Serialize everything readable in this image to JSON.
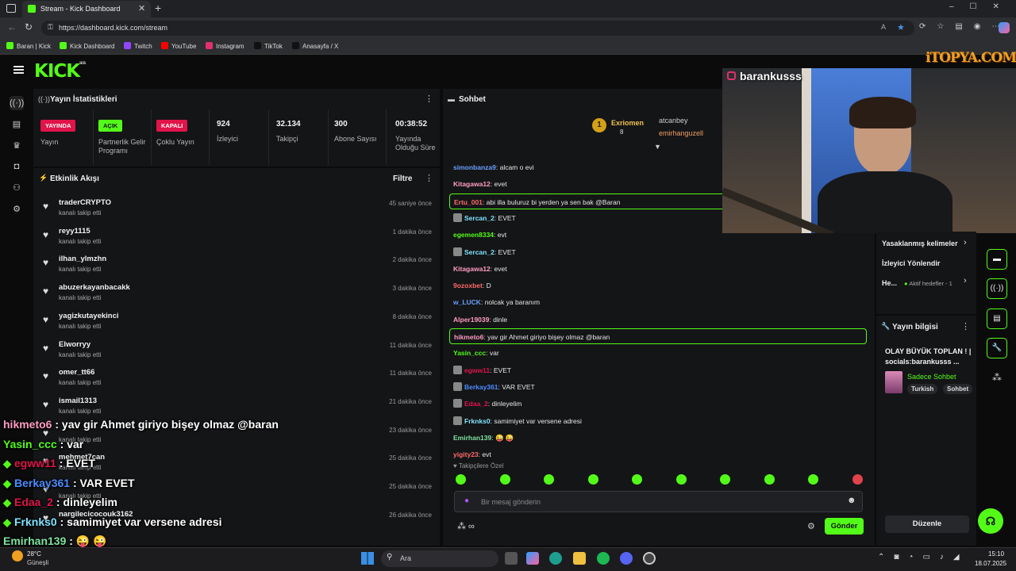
{
  "browser": {
    "tab_title": "Stream - Kick Dashboard",
    "url": "https://dashboard.kick.com/stream",
    "bookmarks": [
      {
        "label": "Baran | Kick",
        "color": "#53fc18"
      },
      {
        "label": "Kick Dashboard",
        "color": "#53fc18"
      },
      {
        "label": "Twitch",
        "color": "#9146ff"
      },
      {
        "label": "YouTube",
        "color": "#ff0000"
      },
      {
        "label": "Instagram",
        "color": "#e1306c"
      },
      {
        "label": "TikTok",
        "color": "#111111"
      },
      {
        "label": "Anasayfa / X",
        "color": "#111111"
      }
    ]
  },
  "kick": {
    "logo": "KICK",
    "logo_beta": "BETA",
    "watermark": "iTOPYA.COM"
  },
  "stats": {
    "title": "Yayın İstatistikleri",
    "items": [
      {
        "badge": "YAYINDA",
        "label": "Yayın",
        "badge_color": "#e0144a"
      },
      {
        "badge": "AÇIK",
        "label": "Partnerlik Gelir Programı",
        "badge_color": "#53fc18"
      },
      {
        "badge": "KAPALI",
        "label": "Çoklu Yayın",
        "badge_color": "#e0144a"
      }
    ],
    "numbers": [
      {
        "value": "924",
        "label": "İzleyici"
      },
      {
        "value": "32.134",
        "label": "Takipçi"
      },
      {
        "value": "300",
        "label": "Abone Sayısı"
      },
      {
        "value": "00:38:52",
        "label": "Yayında Olduğu Süre"
      }
    ]
  },
  "feed": {
    "title": "Etkinlik Akışı",
    "filter": "Filtre",
    "items": [
      {
        "name": "traderCRYPTO",
        "sub": "kanalı takip etti",
        "time": "45 saniye önce"
      },
      {
        "name": "reyy1115",
        "sub": "kanalı takip etti",
        "time": "1 dakika önce"
      },
      {
        "name": "ilhan_ylmzhn",
        "sub": "kanalı takip etti",
        "time": "2 dakika önce"
      },
      {
        "name": "abuzerkayanbacakk",
        "sub": "kanalı takip etti",
        "time": "3 dakika önce"
      },
      {
        "name": "yagizkutayekinci",
        "sub": "kanalı takip etti",
        "time": "8 dakika önce"
      },
      {
        "name": "Elworryy",
        "sub": "kanalı takip etti",
        "time": "11 dakika önce"
      },
      {
        "name": "omer_tt66",
        "sub": "kanalı takip etti",
        "time": "11 dakika önce"
      },
      {
        "name": "ismail1313",
        "sub": "kanalı takip etti",
        "time": "21 dakika önce"
      },
      {
        "name": "",
        "sub": "kanalı takip etti",
        "time": "23 dakika önce"
      },
      {
        "name": "mehmet7can",
        "sub": "kanalı takip etti",
        "time": "25 dakika önce"
      },
      {
        "name": "",
        "sub": "kanalı takip etti",
        "time": "25 dakika önce"
      },
      {
        "name": "nargilecicocouk3162",
        "sub": "",
        "time": "26 dakika önce"
      }
    ]
  },
  "chat": {
    "title": "Sohbet",
    "leaders": {
      "rank": "1",
      "top": "Exriomen",
      "top_count": "8",
      "second": "atcanbey",
      "third": "emirhanguzell"
    },
    "messages": [
      {
        "user": "simonbanza9",
        "text": "alcam o evi",
        "color": "#6aa0ff",
        "hl": false,
        "icon": false
      },
      {
        "user": "Kitagawa12",
        "text": "evet",
        "color": "#ff9cc2",
        "hl": false,
        "icon": false
      },
      {
        "user": "Ertu_001",
        "text": "abi illa buluruz bi yerden ya sen bak @Baran",
        "color": "#ff6a6a",
        "hl": true,
        "icon": false
      },
      {
        "user": "Sercan_2",
        "text": "EVET",
        "color": "#7fe3ff",
        "hl": false,
        "icon": true
      },
      {
        "user": "egemen8334",
        "text": "evt",
        "color": "#53fc18",
        "hl": false,
        "icon": false
      },
      {
        "user": "Sercan_2",
        "text": "EVET",
        "color": "#7fe3ff",
        "hl": false,
        "icon": true
      },
      {
        "user": "Kitagawa12",
        "text": "evet",
        "color": "#ff9cc2",
        "hl": false,
        "icon": false
      },
      {
        "user": "9ozoxbet",
        "text": "D",
        "color": "#ff6a6a",
        "hl": false,
        "icon": false
      },
      {
        "user": "w_LUCK",
        "text": "nolcak ya baranım",
        "color": "#6aa0ff",
        "hl": false,
        "icon": false
      },
      {
        "user": "Alper19039",
        "text": "dinle",
        "color": "#ff9cc2",
        "hl": false,
        "icon": false
      },
      {
        "user": "hikmeto6",
        "text": "yav gir Ahmet giriyo bişey olmaz @baran",
        "color": "#ff9cc2",
        "hl": true,
        "icon": false
      },
      {
        "user": "Yasin_ccc",
        "text": "var",
        "color": "#53fc18",
        "hl": false,
        "icon": false
      },
      {
        "user": "egww11",
        "text": "EVET",
        "color": "#e0144a",
        "hl": false,
        "icon": true
      },
      {
        "user": "Berkay361",
        "text": "VAR EVET",
        "color": "#4a8cff",
        "hl": false,
        "icon": true
      },
      {
        "user": "Edaa_2",
        "text": "dinleyelim",
        "color": "#e0144a",
        "hl": false,
        "icon": true
      },
      {
        "user": "Frknks0",
        "text": "samimiyet var versene adresi",
        "color": "#7fe3ff",
        "hl": false,
        "icon": true
      },
      {
        "user": "Emirhan139",
        "text": "😜 😜",
        "color": "#7fe3a0",
        "hl": false,
        "icon": false
      },
      {
        "user": "yigity23",
        "text": "evt",
        "color": "#ff6a6a",
        "hl": false,
        "icon": false
      }
    ],
    "followers_only": "Takipçilere Özel",
    "input_placeholder": "Bir mesaj gönderin",
    "send": "Gönder"
  },
  "webcam": {
    "handle": "barankusss"
  },
  "right": {
    "items": [
      "Yasaklanmış kelimeler",
      "İzleyici Yönlendir",
      "He..."
    ],
    "active_goals": "Aktif hedefler - 1",
    "info_title": "Yayın bilgisi",
    "stream_title": "OLAY BÜYÜK TOPLAN ! | socials:barankusss ...",
    "category": "Sadece Sohbet",
    "tags": [
      "Turkish",
      "Sohbet"
    ],
    "edit": "Düzenle"
  },
  "overlay": [
    {
      "user": "hikmeto6",
      "text": "yav gir Ahmet giriyo bişey olmaz @baran",
      "color": "#ff9cc2",
      "dia": false
    },
    {
      "user": "Yasin_ccc",
      "text": "var",
      "color": "#53fc18",
      "dia": false
    },
    {
      "user": "egww11",
      "text": "EVET",
      "color": "#e0144a",
      "dia": true
    },
    {
      "user": "Berkay361",
      "text": "VAR EVET",
      "color": "#4a8cff",
      "dia": true
    },
    {
      "user": "Edaa_2",
      "text": "dinleyelim",
      "color": "#e0144a",
      "dia": true
    },
    {
      "user": "Frknks0",
      "text": "samimiyet var versene adresi",
      "color": "#7fe3ff",
      "dia": true
    },
    {
      "user": "Emirhan139",
      "text": "😜 😜",
      "color": "#7fe3a0",
      "dia": false
    }
  ],
  "taskbar": {
    "weather_temp": "28°C",
    "weather_label": "Güneşli",
    "search": "Ara",
    "time": "15:10",
    "date": "18.07.2025"
  },
  "colors": {
    "accent": "#53fc18",
    "live": "#e0144a"
  }
}
